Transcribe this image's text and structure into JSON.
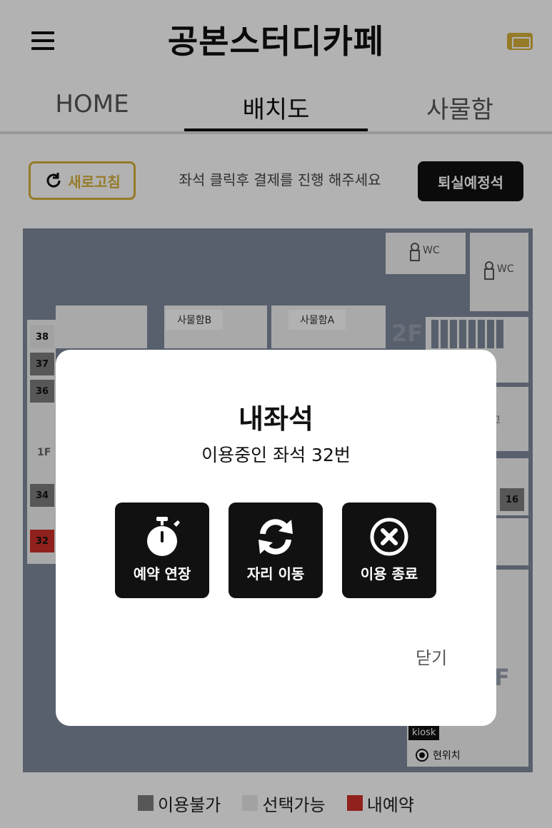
{
  "header": {
    "title": "공본스터디카페",
    "menu_icon": "hamburger-menu-icon",
    "ticket_icon": "ticket-icon"
  },
  "tabs": [
    {
      "label": "HOME",
      "active": false
    },
    {
      "label": "배치도",
      "active": true
    },
    {
      "label": "사물함",
      "active": false
    }
  ],
  "toolbar": {
    "refresh_label": "새로고침",
    "hint": "좌석 클릭후 결제를 진행 해주세요",
    "checkout_label": "퇴실예정석"
  },
  "map": {
    "lockers": [
      "사물함B",
      "사물함A"
    ],
    "restrooms": [
      "WC",
      "WC"
    ],
    "floor_labels": [
      "1F",
      "2F",
      "F"
    ],
    "partial_label": "고",
    "seats": [
      {
        "number": "38",
        "status": "available"
      },
      {
        "number": "37",
        "status": "unavailable"
      },
      {
        "number": "36",
        "status": "unavailable"
      },
      {
        "number": "34",
        "status": "unavailable"
      },
      {
        "number": "32",
        "status": "mine"
      },
      {
        "number": "16",
        "status": "unavailable"
      }
    ],
    "kiosk_label": "kiosk",
    "current_position_label": "현위치"
  },
  "legend": [
    {
      "label": "이용불가",
      "color": "#7d7d7d"
    },
    {
      "label": "선택가능",
      "color": "#e8e8e8"
    },
    {
      "label": "내예약",
      "color": "#d0302a"
    }
  ],
  "modal": {
    "title": "내좌석",
    "subtitle": "이용중인 좌석 32번",
    "actions": [
      {
        "label": "예약 연장",
        "icon": "stopwatch-icon"
      },
      {
        "label": "자리 이동",
        "icon": "refresh-arrows-icon"
      },
      {
        "label": "이용 종료",
        "icon": "close-circle-icon"
      }
    ],
    "close_label": "닫기"
  },
  "colors": {
    "accent_gold": "#d6b13a",
    "map_background": "#7f8a9d",
    "my_reservation": "#d0302a"
  }
}
